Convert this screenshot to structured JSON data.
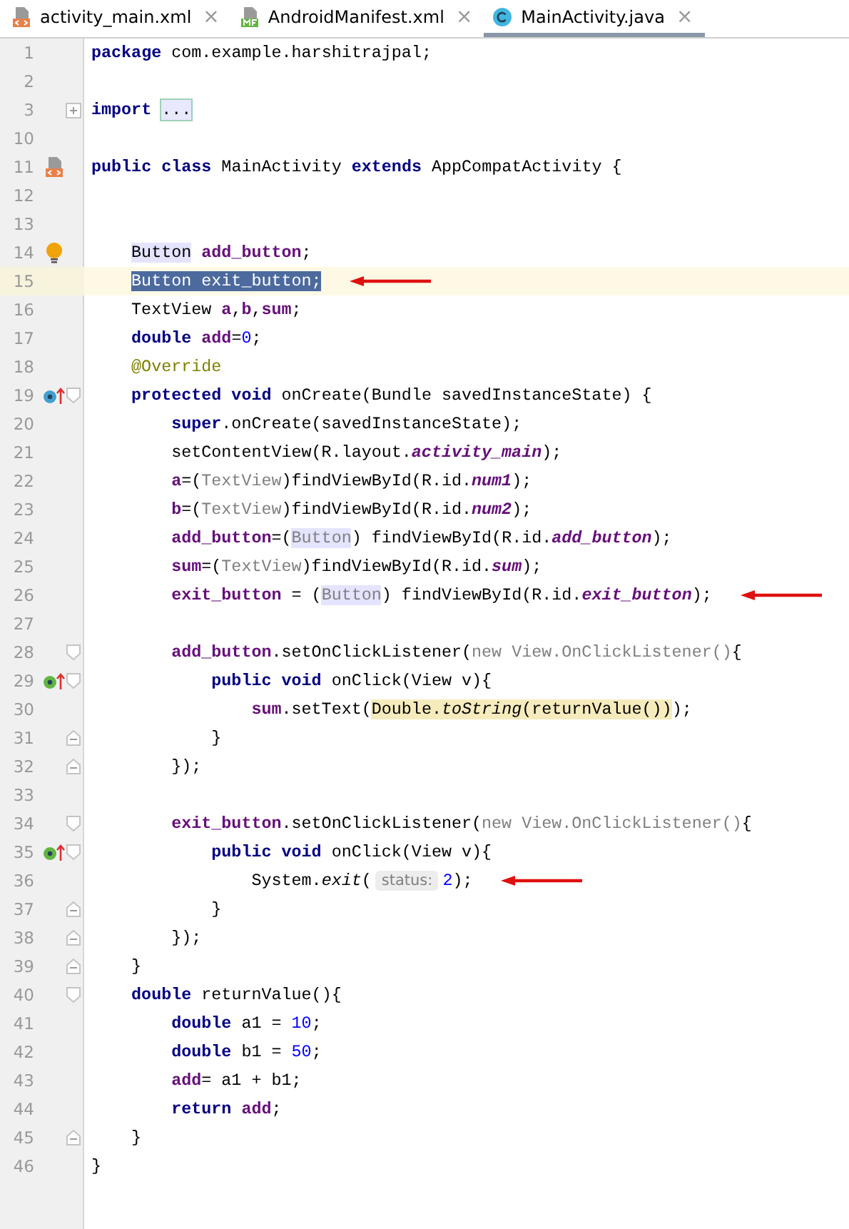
{
  "tabs": [
    {
      "label": "activity_main.xml",
      "kind": "xml",
      "selected": false,
      "close": "×"
    },
    {
      "label": "AndroidManifest.xml",
      "kind": "manifest",
      "selected": false,
      "close": "×"
    },
    {
      "label": "MainActivity.java",
      "kind": "class",
      "selected": true,
      "close": "×"
    }
  ],
  "lines": [
    {
      "number": "1",
      "current": false,
      "arrow": false,
      "tokens": [
        {
          "text": "package",
          "kind": "keyword"
        },
        {
          "text": " com.example.harshitrajpal;",
          "kind": "plain"
        }
      ]
    },
    {
      "number": "2",
      "current": false,
      "arrow": false
    },
    {
      "number": "3",
      "current": false,
      "arrow": false,
      "fold": {
        "kind": "collapsed"
      },
      "tokens": [
        {
          "text": "import ",
          "kind": "keyword"
        },
        {
          "text": "...",
          "kind": "folded"
        }
      ]
    },
    {
      "number": "10",
      "current": false,
      "arrow": false
    },
    {
      "number": "11",
      "current": false,
      "arrow": false,
      "gutter_icon": {
        "kind": "xml"
      },
      "tokens": [
        {
          "text": "public class",
          "kind": "keyword"
        },
        {
          "text": " MainActivity ",
          "kind": "plain"
        },
        {
          "text": "extends",
          "kind": "keyword"
        },
        {
          "text": " AppCompatActivity {",
          "kind": "plain"
        }
      ],
      "children": [
        {
          "number": "12",
          "current": false,
          "arrow": false
        },
        {
          "number": "13",
          "current": false,
          "arrow": false
        },
        {
          "number": "14",
          "current": false,
          "arrow": false,
          "gutter_icon": {
            "kind": "bulb"
          },
          "tokens": [
            {
              "text": "Button",
              "kind": "usage"
            },
            {
              "text": " add_button",
              "kind": "field"
            },
            {
              "text": ";",
              "kind": "plain"
            }
          ]
        },
        {
          "number": "15",
          "current": true,
          "arrow": true,
          "tokens": [
            {
              "text": "Button exit_button;",
              "kind": "selection"
            }
          ]
        },
        {
          "number": "16",
          "current": false,
          "arrow": false,
          "tokens": [
            {
              "text": "TextView ",
              "kind": "plain"
            },
            {
              "text": "a",
              "kind": "field"
            },
            {
              "text": ",",
              "kind": "plain"
            },
            {
              "text": "b",
              "kind": "field"
            },
            {
              "text": ",",
              "kind": "plain"
            },
            {
              "text": "sum",
              "kind": "field"
            },
            {
              "text": ";",
              "kind": "plain"
            }
          ]
        },
        {
          "number": "17",
          "current": false,
          "arrow": false,
          "tokens": [
            {
              "text": "double",
              "kind": "keyword"
            },
            {
              "text": " add",
              "kind": "field"
            },
            {
              "text": "=",
              "kind": "plain"
            },
            {
              "text": "0",
              "kind": "number"
            },
            {
              "text": ";",
              "kind": "plain"
            }
          ]
        },
        {
          "number": "18",
          "current": false,
          "arrow": false,
          "tokens": [
            {
              "text": "@Override",
              "kind": "annotation"
            }
          ]
        },
        {
          "number": "19",
          "current": false,
          "arrow": false,
          "gutter_icon": {
            "kind": "override"
          },
          "fold": {
            "kind": "start"
          },
          "tokens": [
            {
              "text": "protected void",
              "kind": "keyword"
            },
            {
              "text": " onCreate(Bundle savedInstanceState) {",
              "kind": "plain"
            }
          ],
          "children": [
            {
              "number": "20",
              "current": false,
              "arrow": false,
              "tokens": [
                {
                  "text": "super",
                  "kind": "keyword"
                },
                {
                  "text": ".onCreate(savedInstanceState);",
                  "kind": "plain"
                }
              ]
            },
            {
              "number": "21",
              "current": false,
              "arrow": false,
              "tokens": [
                {
                  "text": "setContentView(R.layout.",
                  "kind": "plain"
                },
                {
                  "text": "activity_main",
                  "kind": "static"
                },
                {
                  "text": ");",
                  "kind": "plain"
                }
              ]
            },
            {
              "number": "22",
              "current": false,
              "arrow": false,
              "tokens": [
                {
                  "text": "a",
                  "kind": "field"
                },
                {
                  "text": "=(",
                  "kind": "plain"
                },
                {
                  "text": "TextView",
                  "kind": "cast"
                },
                {
                  "text": ")findViewById(R.id.",
                  "kind": "plain"
                },
                {
                  "text": "num1",
                  "kind": "static"
                },
                {
                  "text": ");",
                  "kind": "plain"
                }
              ]
            },
            {
              "number": "23",
              "current": false,
              "arrow": false,
              "tokens": [
                {
                  "text": "b",
                  "kind": "field"
                },
                {
                  "text": "=(",
                  "kind": "plain"
                },
                {
                  "text": "TextView",
                  "kind": "cast"
                },
                {
                  "text": ")findViewById(R.id.",
                  "kind": "plain"
                },
                {
                  "text": "num2",
                  "kind": "static"
                },
                {
                  "text": ");",
                  "kind": "plain"
                }
              ]
            },
            {
              "number": "24",
              "current": false,
              "arrow": false,
              "tokens": [
                {
                  "text": "add_button",
                  "kind": "field"
                },
                {
                  "text": "=(",
                  "kind": "plain"
                },
                {
                  "text": "Button",
                  "kind": "usage-cast"
                },
                {
                  "text": ") findViewById(R.id.",
                  "kind": "plain"
                },
                {
                  "text": "add_button",
                  "kind": "static"
                },
                {
                  "text": ");",
                  "kind": "plain"
                }
              ]
            },
            {
              "number": "25",
              "current": false,
              "arrow": false,
              "tokens": [
                {
                  "text": "sum",
                  "kind": "field"
                },
                {
                  "text": "=(",
                  "kind": "plain"
                },
                {
                  "text": "TextView",
                  "kind": "cast"
                },
                {
                  "text": ")findViewById(R.id.",
                  "kind": "plain"
                },
                {
                  "text": "sum",
                  "kind": "static"
                },
                {
                  "text": ");",
                  "kind": "plain"
                }
              ]
            },
            {
              "number": "26",
              "current": false,
              "arrow": true,
              "tokens": [
                {
                  "text": "exit_button",
                  "kind": "field"
                },
                {
                  "text": " = (",
                  "kind": "plain"
                },
                {
                  "text": "Button",
                  "kind": "usage-cast"
                },
                {
                  "text": ") findViewById(R.id.",
                  "kind": "plain"
                },
                {
                  "text": "exit_button",
                  "kind": "static"
                },
                {
                  "text": ");",
                  "kind": "plain"
                }
              ]
            },
            {
              "number": "27",
              "current": false,
              "arrow": false
            },
            {
              "number": "28",
              "current": false,
              "arrow": false,
              "fold": {
                "kind": "start"
              },
              "tokens": [
                {
                  "text": "add_button",
                  "kind": "field"
                },
                {
                  "text": ".setOnClickListener(",
                  "kind": "plain"
                },
                {
                  "text": "new View.OnClickListener()",
                  "kind": "cast"
                },
                {
                  "text": "{",
                  "kind": "plain"
                }
              ],
              "children": [
                {
                  "number": "29",
                  "current": false,
                  "arrow": false,
                  "gutter_icon": {
                    "kind": "implement"
                  },
                  "fold": {
                    "kind": "start"
                  },
                  "tokens": [
                    {
                      "text": "public void",
                      "kind": "keyword"
                    },
                    {
                      "text": " onClick(View v){",
                      "kind": "plain"
                    }
                  ],
                  "children": [
                    {
                      "number": "30",
                      "current": false,
                      "arrow": false,
                      "tokens": [
                        {
                          "text": "sum",
                          "kind": "field"
                        },
                        {
                          "text": ".setText(",
                          "kind": "plain"
                        },
                        {
                          "text": "Double.*toString*(returnValue())",
                          "kind": "warning"
                        },
                        {
                          "text": ");",
                          "kind": "plain"
                        }
                      ]
                    }
                  ]
                },
                {
                  "number": "31",
                  "current": false,
                  "arrow": false,
                  "fold": {
                    "kind": "end"
                  },
                  "tokens": [
                    {
                      "text": "}",
                      "kind": "plain"
                    }
                  ]
                }
              ]
            },
            {
              "number": "32",
              "current": false,
              "arrow": false,
              "fold": {
                "kind": "end"
              },
              "tokens": [
                {
                  "text": "});",
                  "kind": "plain"
                }
              ]
            },
            {
              "number": "33",
              "current": false,
              "arrow": false
            },
            {
              "number": "34",
              "current": false,
              "arrow": false,
              "fold": {
                "kind": "start"
              },
              "tokens": [
                {
                  "text": "exit_button",
                  "kind": "field"
                },
                {
                  "text": ".setOnClickListener(",
                  "kind": "plain"
                },
                {
                  "text": "new View.OnClickListener()",
                  "kind": "cast"
                },
                {
                  "text": "{",
                  "kind": "plain"
                }
              ],
              "children": [
                {
                  "number": "35",
                  "current": false,
                  "arrow": false,
                  "gutter_icon": {
                    "kind": "implement"
                  },
                  "fold": {
                    "kind": "start"
                  },
                  "tokens": [
                    {
                      "text": "public void",
                      "kind": "keyword"
                    },
                    {
                      "text": " onClick(View v){",
                      "kind": "plain"
                    }
                  ],
                  "children": [
                    {
                      "number": "36",
                      "current": false,
                      "arrow": true,
                      "tokens": [
                        {
                          "text": "System.*exit*(",
                          "kind": "plain"
                        },
                        {
                          "text": "status:",
                          "kind": "hint"
                        },
                        {
                          "text": "2",
                          "kind": "number"
                        },
                        {
                          "text": ");",
                          "kind": "plain"
                        }
                      ]
                    }
                  ]
                },
                {
                  "number": "37",
                  "current": false,
                  "arrow": false,
                  "fold": {
                    "kind": "end"
                  },
                  "tokens": [
                    {
                      "text": "}",
                      "kind": "plain"
                    }
                  ]
                }
              ]
            },
            {
              "number": "38",
              "current": false,
              "arrow": false,
              "fold": {
                "kind": "end"
              },
              "tokens": [
                {
                  "text": "});",
                  "kind": "plain"
                }
              ]
            }
          ]
        },
        {
          "number": "39",
          "current": false,
          "arrow": false,
          "fold": {
            "kind": "end"
          },
          "tokens": [
            {
              "text": "}",
              "kind": "plain"
            }
          ]
        },
        {
          "number": "40",
          "current": false,
          "arrow": false,
          "fold": {
            "kind": "start"
          },
          "tokens": [
            {
              "text": "double",
              "kind": "keyword"
            },
            {
              "text": " returnValue(){",
              "kind": "plain"
            }
          ],
          "children": [
            {
              "number": "41",
              "current": false,
              "arrow": false,
              "tokens": [
                {
                  "text": "double",
                  "kind": "keyword"
                },
                {
                  "text": " a1 = ",
                  "kind": "plain"
                },
                {
                  "text": "10",
                  "kind": "number"
                },
                {
                  "text": ";",
                  "kind": "plain"
                }
              ]
            },
            {
              "number": "42",
              "current": false,
              "arrow": false,
              "tokens": [
                {
                  "text": "double",
                  "kind": "keyword"
                },
                {
                  "text": " b1 = ",
                  "kind": "plain"
                },
                {
                  "text": "50",
                  "kind": "number"
                },
                {
                  "text": ";",
                  "kind": "plain"
                }
              ]
            },
            {
              "number": "43",
              "current": false,
              "arrow": false,
              "tokens": [
                {
                  "text": "add",
                  "kind": "field"
                },
                {
                  "text": "= a1 + b1;",
                  "kind": "plain"
                }
              ]
            },
            {
              "number": "44",
              "current": false,
              "arrow": false,
              "tokens": [
                {
                  "text": "return",
                  "kind": "keyword"
                },
                {
                  "text": " add",
                  "kind": "field"
                },
                {
                  "text": ";",
                  "kind": "plain"
                }
              ]
            }
          ]
        },
        {
          "number": "45",
          "current": false,
          "arrow": false,
          "fold": {
            "kind": "end"
          },
          "tokens": [
            {
              "text": "}",
              "kind": "plain"
            }
          ]
        }
      ]
    },
    {
      "number": "46",
      "current": false,
      "arrow": false,
      "tokens": [
        {
          "text": "}",
          "kind": "plain"
        }
      ]
    }
  ]
}
